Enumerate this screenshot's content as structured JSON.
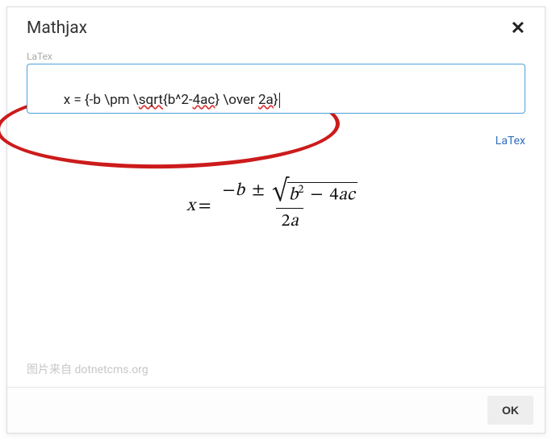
{
  "dialog": {
    "title": "Mathjax"
  },
  "field": {
    "label": "LaTex",
    "value": "x = {-b \\pm \\sqrt{b^2-4ac} \\over 2a}",
    "seg_prefix": "x = {-b \\pm \\",
    "seg_sqrt": "sqrt",
    "seg_mid1": "{b^2-",
    "seg_4ac": "4ac",
    "seg_mid2": "} \\over ",
    "seg_2a": "2a",
    "seg_suffix": "}"
  },
  "link": {
    "latex": "LaTex"
  },
  "preview": {
    "x": "x",
    "eq": "=",
    "minus": "−",
    "b": "b",
    "pm": "±",
    "b2_b": "b",
    "b2_exp": "2",
    "minus2": "−",
    "four": "4",
    "a": "a",
    "c": "c",
    "two": "2",
    "a2": "a"
  },
  "watermark": "图片来自 dotnetcms.org",
  "footer": {
    "ok": "OK"
  }
}
